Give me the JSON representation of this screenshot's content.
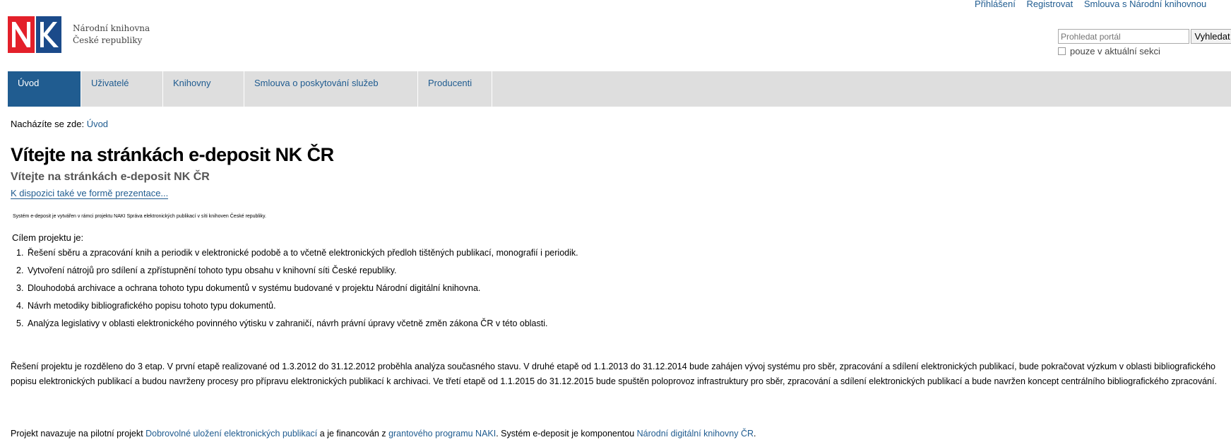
{
  "personal_bar": {
    "items": [
      "Přihlášení",
      "Registrovat",
      "Smlouva s Národní knihovnou"
    ]
  },
  "logo": {
    "letters": "NK",
    "line1": "Národní knihovna",
    "line2": "České republiky"
  },
  "search": {
    "placeholder": "Prohledat portál",
    "button_label": "Vyhledat",
    "scope_label": "pouze v aktuální sekci"
  },
  "nav": {
    "items": [
      {
        "label": "Úvod",
        "active": true
      },
      {
        "label": "Uživatelé",
        "active": false
      },
      {
        "label": "Knihovny",
        "active": false
      },
      {
        "label": "Smlouva o poskytování služeb",
        "active": false
      },
      {
        "label": "Producenti",
        "active": false
      }
    ]
  },
  "breadcrumb": {
    "prefix": "Nacházíte se zde:",
    "current": "Úvod"
  },
  "main": {
    "title": "Vítejte na stránkách e-deposit NK ČR",
    "subtitle": "Vítejte na stránkách e-deposit NK ČR",
    "presentation_link": "K dispozici také ve formě prezentace...",
    "small_note": "Systém e-deposit je vytvářen v rámci projektu NAKI Správa elektronických publikací v síti knihoven České republiky.",
    "goals_intro": "Cílem projektu je:",
    "goals": [
      {
        "num": "1.",
        "text": "Řešení sběru a zpracování knih a periodik v elektronické podobě a to včetně elektronických předloh tištěných publikací, monografií i periodik."
      },
      {
        "num": "2.",
        "text": "Vytvoření nátrojů pro sdílení a zpřístupnění tohoto typu obsahu v knihovní síti České republiky."
      },
      {
        "num": "3.",
        "text": "Dlouhodobá archivace a ochrana tohoto typu dokumentů v systému budované v projektu Národní digitální knihovna."
      },
      {
        "num": "4.",
        "text": "Návrh metodiky bibliografického popisu tohoto typu dokumentů."
      },
      {
        "num": "5.",
        "text": "Analýza legislativy v oblasti elektronického povinného výtisku v zahraničí, návrh právní úpravy včetně změn zákona ČR v této oblasti."
      }
    ],
    "paragraph": "Řešení projektu je rozděleno do 3 etap. V první etapě realizované od 1.3.2012 do 31.12.2012 proběhla analýza současného stavu. V druhé etapě od 1.1.2013 do 31.12.2014 bude zahájen vývoj systému pro sběr, zpracování a sdílení elektronických publikací, bude pokračovat výzkum v oblasti bibliografického popisu elektronických publikací a budou navrženy procesy pro přípravu elektronických publikací k archivaci. Ve třetí etapě od 1.1.2015 do 31.12.2015 bude spuštěn poloprovoz infrastruktury pro sběr, zpracování a sdílení elektronických publikací a bude navržen koncept centrálního bibliografického zpracování.",
    "last": {
      "text1": "Projekt navazuje na pilotní projekt ",
      "link1": "Dobrovolné uložení elektronických publikací",
      "text2": " a je financován z ",
      "link2": "grantového programu NAKI",
      "text3": ". Systém e-deposit je komponentou ",
      "link3": "Národní digitální knihovny ČR",
      "text4": "."
    }
  },
  "colors": {
    "brand_red": "#e3202a",
    "brand_blue": "#1b4a8a",
    "link": "#205c90",
    "nav_bg": "#dedede"
  }
}
